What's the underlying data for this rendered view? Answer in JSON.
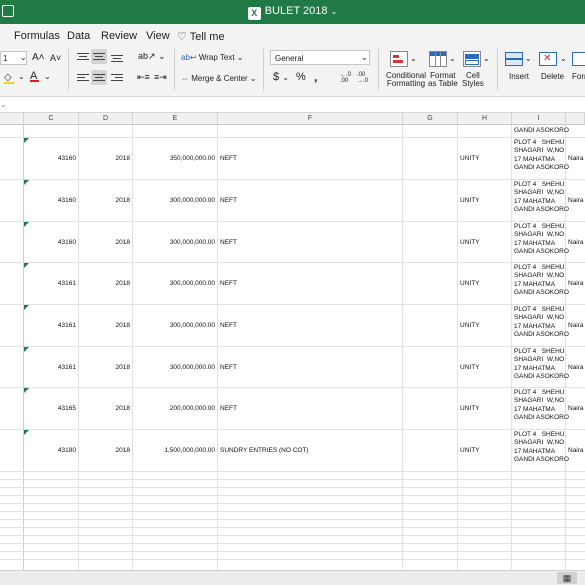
{
  "window": {
    "title": "BULET 2018"
  },
  "tabs": [
    "Formulas",
    "Data",
    "Review",
    "View",
    "Tell me"
  ],
  "ribbon": {
    "font_size": "1",
    "wrap_text": "Wrap Text",
    "merge_center": "Merge & Center",
    "number_format": "General",
    "decimal_inc": "←.0\n.00",
    "decimal_dec": ".00\n→.0",
    "conditional_formatting": [
      "Conditional",
      "Formatting"
    ],
    "format_as_table": [
      "Format",
      "as Table"
    ],
    "cell_styles": [
      "Cell",
      "Styles"
    ],
    "insert": "Insert",
    "delete": "Delete",
    "format": "Forr"
  },
  "columns": [
    "C",
    "D",
    "E",
    "F",
    "G",
    "H",
    "I"
  ],
  "rows": [
    {
      "c": "43160",
      "d": "2018",
      "e": "350,000,000.00",
      "f": "NEFT",
      "h": "UNITY",
      "i": "PLOT 4   SHEHU\nSHAGARI  W,NO\n17 MAHATMA\nGANDI ASOKORO",
      "j": "Naira"
    },
    {
      "c": "43160",
      "d": "2018",
      "e": "300,000,000.00",
      "f": "NEFT",
      "h": "UNITY",
      "i": "PLOT 4   SHEHU\nSHAGARI  W,NO\n17 MAHATMA\nGANDI ASOKORO",
      "j": "Naira"
    },
    {
      "c": "43160",
      "d": "2018",
      "e": "300,000,000.00",
      "f": "NEFT",
      "h": "UNITY",
      "i": "PLOT 4   SHEHU\nSHAGARI  W,NO\n17 MAHATMA\nGANDI ASOKORO",
      "j": "Naira"
    },
    {
      "c": "43161",
      "d": "2018",
      "e": "300,000,000.00",
      "f": "NEFT",
      "h": "UNITY",
      "i": "PLOT 4   SHEHU\nSHAGARI  W,NO\n17 MAHATMA\nGANDI ASOKORO",
      "j": "Naira"
    },
    {
      "c": "43161",
      "d": "2018",
      "e": "300,000,000.00",
      "f": "NEFT",
      "h": "UNITY",
      "i": "PLOT 4   SHEHU\nSHAGARI  W,NO\n17 MAHATMA\nGANDI ASOKORO",
      "j": "Naira"
    },
    {
      "c": "43161",
      "d": "2018",
      "e": "300,000,000.00",
      "f": "NEFT",
      "h": "UNITY",
      "i": "PLOT 4   SHEHU\nSHAGARI  W,NO\n17 MAHATMA\nGANDI ASOKORO",
      "j": "Naira"
    },
    {
      "c": "43165",
      "d": "2018",
      "e": "200,000,000.00",
      "f": "NEFT",
      "h": "UNITY",
      "i": "PLOT 4   SHEHU\nSHAGARI  W,NO\n17 MAHATMA\nGANDI ASOKORO",
      "j": "Naira"
    },
    {
      "c": "43180",
      "d": "2018",
      "e": "1,500,000,000.00",
      "f": "SUNDRY ENTRIES (NO COT)",
      "h": "UNITY",
      "i": "PLOT 4   SHEHU\nSHAGARI  W,NO\n17 MAHATMA\nGANDI ASOKORO",
      "j": "Naira"
    }
  ],
  "top_partial_text": "GANDI ASOKORO",
  "colors": {
    "titlebar": "#1f7a45",
    "ribbon": "#f3f3f3",
    "accent": "#1f7a45"
  }
}
